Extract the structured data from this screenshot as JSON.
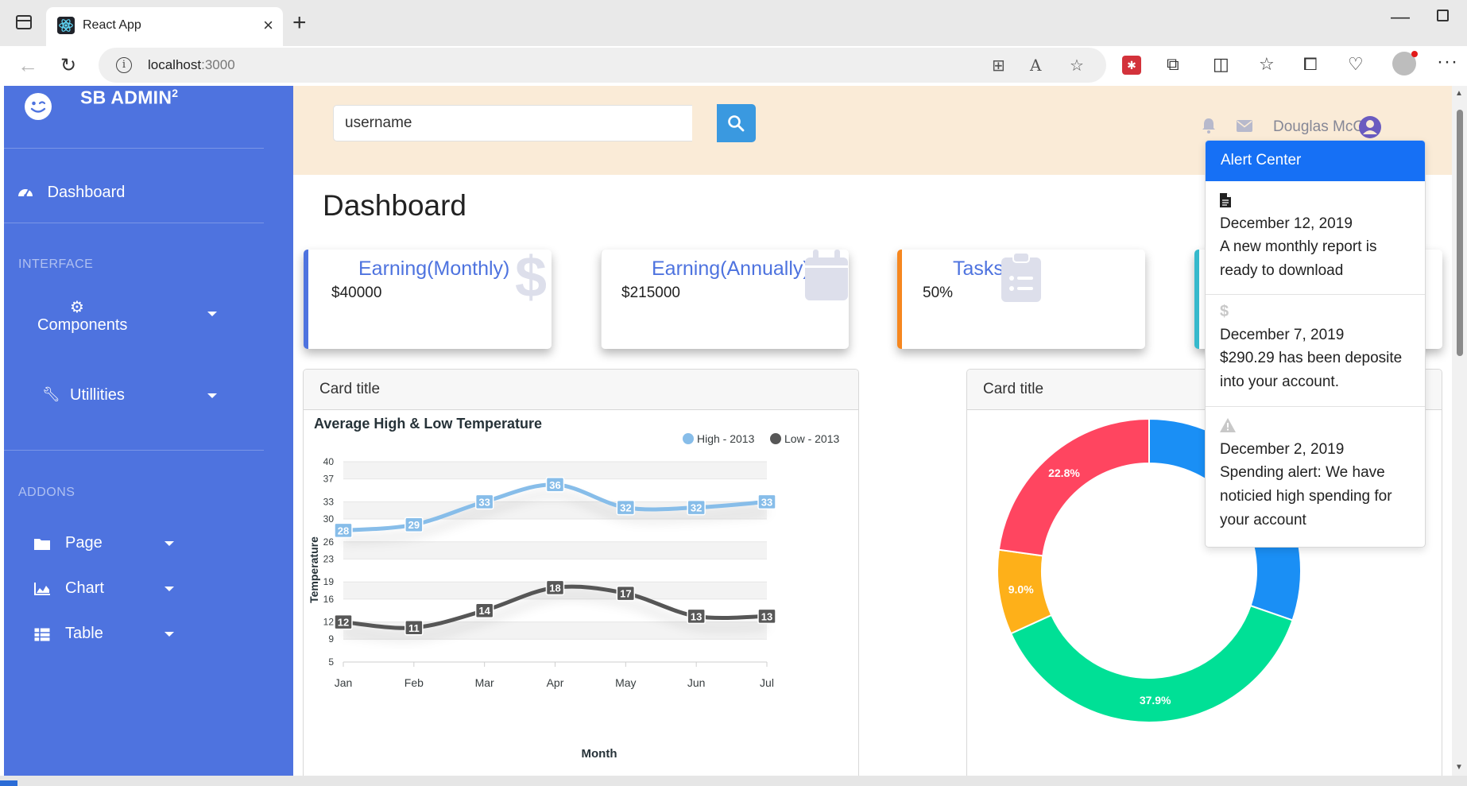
{
  "browser": {
    "tab_title": "React App",
    "url_host": "localhost",
    "url_port": ":3000"
  },
  "sidebar": {
    "brand_text": "SB ADMIN",
    "brand_sup": "2",
    "dashboard": "Dashboard",
    "heading_interface": "INTERFACE",
    "components": "Components",
    "utilities": "Utillities",
    "heading_addons": "ADDONS",
    "page": "Page",
    "chart": "Chart",
    "table": "Table"
  },
  "topbar": {
    "search_value": "username",
    "user_name": "Douglas McGee"
  },
  "page_title": "Dashboard",
  "stats": [
    {
      "title": "Earning(Monthly)",
      "value": "$40000",
      "icon": "dollar-icon",
      "color": "#4e73df"
    },
    {
      "title": "Earning(Annually)",
      "value": "$215000",
      "icon": "calendar-icon",
      "color": "#1cc88a"
    },
    {
      "title": "Tasks",
      "value": "50%",
      "icon": "clipboard-list-icon",
      "color": "#f6871f"
    },
    {
      "title": "",
      "value": "",
      "icon": "",
      "color": "#36b9cc"
    }
  ],
  "cards": {
    "line_card_title": "Card title",
    "donut_card_title": "Card title"
  },
  "alert_center": {
    "title": "Alert Center",
    "items": [
      {
        "icon": "file-icon",
        "date": "December 12, 2019",
        "text": "A new monthly report is ready to download"
      },
      {
        "icon": "dollar-icon",
        "date": "December 7, 2019",
        "text": "$290.29 has been deposite into your account."
      },
      {
        "icon": "warning-icon",
        "date": "December 2, 2019",
        "text": "Spending alert: We have noticied high spending for your account"
      }
    ]
  },
  "chart_data": [
    {
      "type": "line",
      "title": "Average High & Low Temperature",
      "xlabel": "Month",
      "ylabel": "Temperature",
      "categories": [
        "Jan",
        "Feb",
        "Mar",
        "Apr",
        "May",
        "Jun",
        "Jul"
      ],
      "yticks": [
        5,
        9,
        12,
        16,
        19,
        23,
        26,
        30,
        33,
        37,
        40
      ],
      "ylim": [
        5,
        40
      ],
      "grid": true,
      "legend_position": "top-right",
      "series": [
        {
          "name": "High - 2013",
          "values": [
            28,
            29,
            33,
            36,
            32,
            32,
            33
          ],
          "color": "#87bde9"
        },
        {
          "name": "Low - 2013",
          "values": [
            12,
            11,
            14,
            18,
            17,
            13,
            13
          ],
          "color": "#575757"
        }
      ]
    },
    {
      "type": "pie",
      "donut": true,
      "slices": [
        {
          "value": 30.3,
          "label": "",
          "color": "#1a8ff5"
        },
        {
          "value": 37.9,
          "label": "37.9%",
          "color": "#00e096"
        },
        {
          "value": 9.0,
          "label": "9.0%",
          "color": "#feb019"
        },
        {
          "value": 22.8,
          "label": "22.8%",
          "color": "#ff4560"
        }
      ]
    }
  ]
}
